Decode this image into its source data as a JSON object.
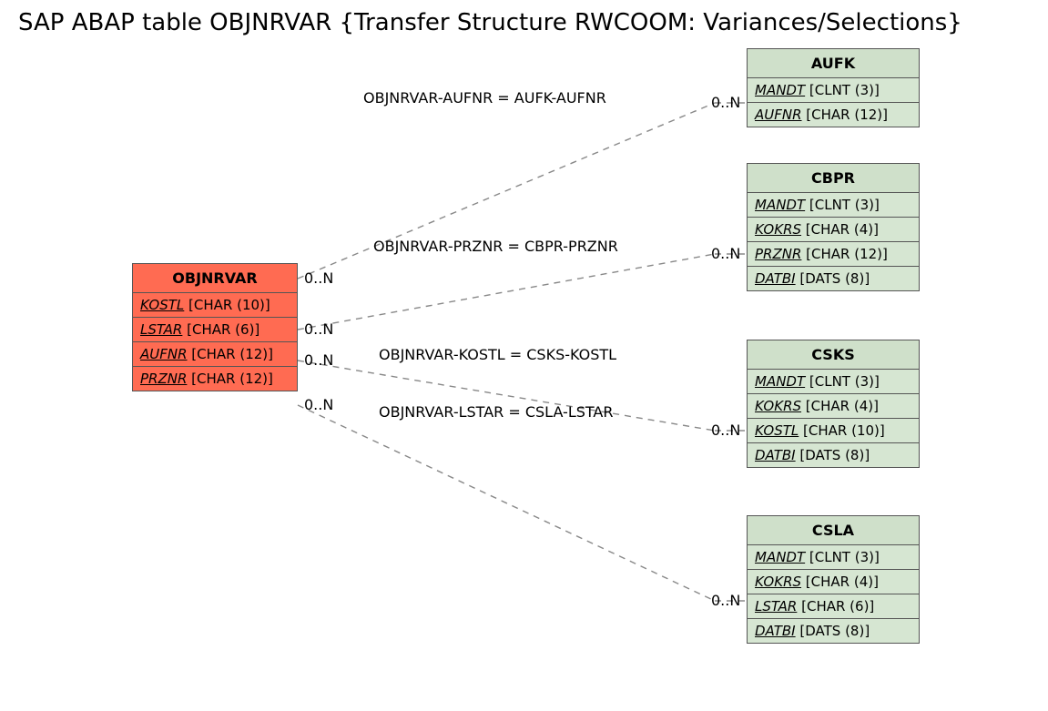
{
  "title": "SAP ABAP table OBJNRVAR {Transfer Structure RWCOOM: Variances/Selections}",
  "main": {
    "name": "OBJNRVAR",
    "fields": [
      {
        "fname": "KOSTL",
        "ftype": " [CHAR (10)]"
      },
      {
        "fname": "LSTAR",
        "ftype": " [CHAR (6)]"
      },
      {
        "fname": "AUFNR",
        "ftype": " [CHAR (12)]"
      },
      {
        "fname": "PRZNR",
        "ftype": " [CHAR (12)]"
      }
    ]
  },
  "targets": [
    {
      "name": "AUFK",
      "fields": [
        {
          "fname": "MANDT",
          "ftype": " [CLNT (3)]"
        },
        {
          "fname": "AUFNR",
          "ftype": " [CHAR (12)]"
        }
      ]
    },
    {
      "name": "CBPR",
      "fields": [
        {
          "fname": "MANDT",
          "ftype": " [CLNT (3)]"
        },
        {
          "fname": "KOKRS",
          "ftype": " [CHAR (4)]"
        },
        {
          "fname": "PRZNR",
          "ftype": " [CHAR (12)]"
        },
        {
          "fname": "DATBI",
          "ftype": " [DATS (8)]"
        }
      ]
    },
    {
      "name": "CSKS",
      "fields": [
        {
          "fname": "MANDT",
          "ftype": " [CLNT (3)]"
        },
        {
          "fname": "KOKRS",
          "ftype": " [CHAR (4)]"
        },
        {
          "fname": "KOSTL",
          "ftype": " [CHAR (10)]"
        },
        {
          "fname": "DATBI",
          "ftype": " [DATS (8)]"
        }
      ]
    },
    {
      "name": "CSLA",
      "fields": [
        {
          "fname": "MANDT",
          "ftype": " [CLNT (3)]"
        },
        {
          "fname": "KOKRS",
          "ftype": " [CHAR (4)]"
        },
        {
          "fname": "LSTAR",
          "ftype": " [CHAR (6)]"
        },
        {
          "fname": "DATBI",
          "ftype": " [DATS (8)]"
        }
      ]
    }
  ],
  "rels": [
    {
      "text": "OBJNRVAR-AUFNR = AUFK-AUFNR",
      "lm": "0..N",
      "rm": "0..N"
    },
    {
      "text": "OBJNRVAR-PRZNR = CBPR-PRZNR",
      "lm": "0..N",
      "rm": "0..N"
    },
    {
      "text": "OBJNRVAR-KOSTL = CSKS-KOSTL",
      "lm": "0..N",
      "rm": "0..N"
    },
    {
      "text": "OBJNRVAR-LSTAR = CSLA-LSTAR",
      "lm": "0..N",
      "rm": "0..N"
    }
  ]
}
